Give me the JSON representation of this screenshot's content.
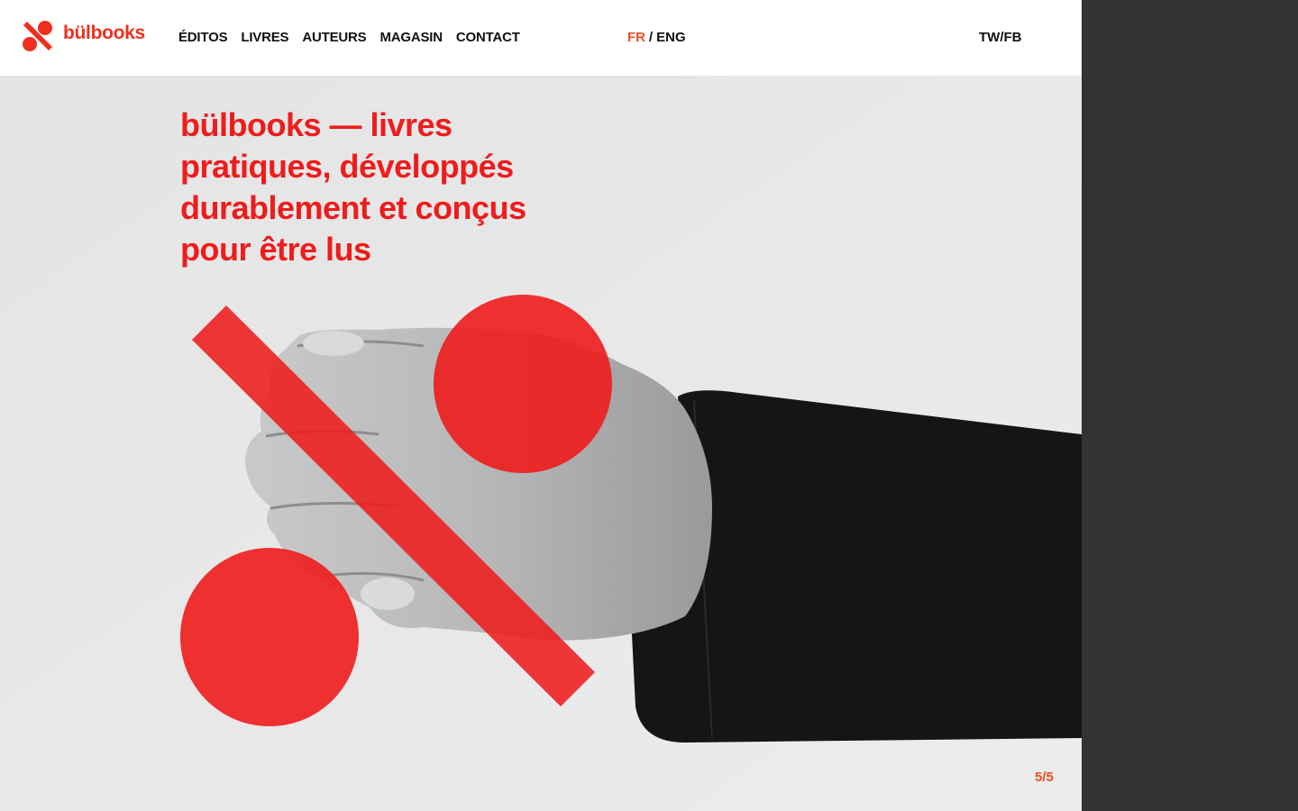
{
  "brand": {
    "name": "bülbooks",
    "accent": "#ef2f1f",
    "headline_color": "#ee1c1c"
  },
  "nav": {
    "items": [
      "ÉDITOS",
      "LIVRES",
      "AUTEURS",
      "MAGASIN",
      "CONTACT"
    ]
  },
  "language": {
    "active": "FR",
    "separator": "/",
    "other": "ENG"
  },
  "social": {
    "label": "TW/FB"
  },
  "hero": {
    "headline": "bülbooks — livres pratiques, développés durablement et conçus pour être lus",
    "image_description_icon": "hand-holding-percent-sign-artwork"
  },
  "slider": {
    "counter": "5/5"
  },
  "colors": {
    "header_bg": "#ffffff",
    "main_bg": "#e7e7e7",
    "side_panel": "#333335",
    "nav_text": "#111111"
  }
}
